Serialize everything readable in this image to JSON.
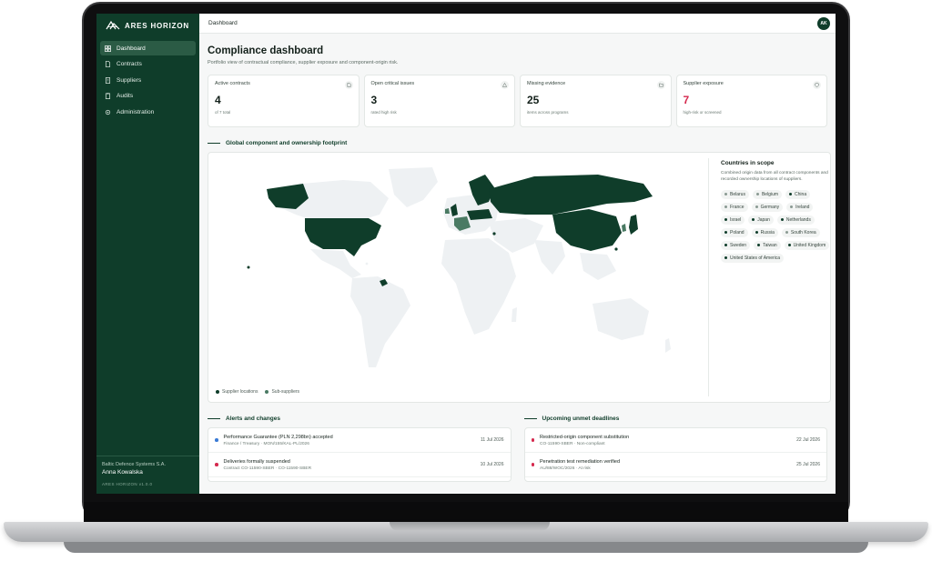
{
  "brand": {
    "name": "ARES HORIZON"
  },
  "topbar": {
    "breadcrumb": "Dashboard",
    "avatar": "AK"
  },
  "sidebar": {
    "items": [
      {
        "label": "Dashboard",
        "icon": "grid-icon"
      },
      {
        "label": "Contracts",
        "icon": "document-icon"
      },
      {
        "label": "Suppliers",
        "icon": "building-icon"
      },
      {
        "label": "Audits",
        "icon": "clipboard-icon"
      },
      {
        "label": "Administration",
        "icon": "gear-icon"
      }
    ],
    "active": "Dashboard",
    "org": "Baltic Defence Systems S.A.",
    "user": "Anna Kowalska",
    "version": "ARES HORIZON v1.0.0"
  },
  "page": {
    "title": "Compliance dashboard",
    "subtitle": "Portfolio view of contractual compliance, supplier exposure and component-origin risk."
  },
  "kpis": [
    {
      "label": "Active contracts",
      "value": "4",
      "foot": "of 7 total",
      "icon": "file-icon",
      "alert": false
    },
    {
      "label": "Open critical issues",
      "value": "3",
      "foot": "rated high risk",
      "icon": "warning-icon",
      "alert": false
    },
    {
      "label": "Missing evidence",
      "value": "25",
      "foot": "items across programs",
      "icon": "folder-icon",
      "alert": false
    },
    {
      "label": "Supplier exposure",
      "value": "7",
      "foot": "high-risk or screened",
      "icon": "shield-icon",
      "alert": true
    }
  ],
  "map_section": {
    "title": "Global component and ownership footprint",
    "legend": [
      {
        "label": "Supplier locations",
        "color": "#0f3d2a"
      },
      {
        "label": "Sub-suppliers",
        "color": "#4a7a63"
      }
    ],
    "scope_title": "Countries in scope",
    "scope_desc": "Combined origin data from all contract components and recorded ownership locations of suppliers.",
    "countries": [
      {
        "name": "Belarus",
        "type": "sub"
      },
      {
        "name": "Belgium",
        "type": "sub"
      },
      {
        "name": "China",
        "type": "main"
      },
      {
        "name": "France",
        "type": "sub"
      },
      {
        "name": "Germany",
        "type": "sub"
      },
      {
        "name": "Ireland",
        "type": "sub"
      },
      {
        "name": "Israel",
        "type": "main"
      },
      {
        "name": "Japan",
        "type": "main"
      },
      {
        "name": "Netherlands",
        "type": "main"
      },
      {
        "name": "Poland",
        "type": "main"
      },
      {
        "name": "Russia",
        "type": "main"
      },
      {
        "name": "South Korea",
        "type": "sub"
      },
      {
        "name": "Sweden",
        "type": "main"
      },
      {
        "name": "Taiwan",
        "type": "main"
      },
      {
        "name": "United Kingdom",
        "type": "main"
      },
      {
        "name": "United States of America",
        "type": "main"
      }
    ]
  },
  "alerts": {
    "title": "Alerts and changes",
    "items": [
      {
        "title": "Performance Guarantee (PLN 2,298bn) accepted",
        "sub": "Finance / Treasury · MON/155/KAL-PL/2026",
        "date": "11 Jul 2026",
        "color": "#3a7bd5"
      },
      {
        "title": "Deliveries formally suspended",
        "sub": "Contract CO-11590-SBER · CO-11590-SBER",
        "date": "10 Jul 2026",
        "color": "#d5294e"
      }
    ]
  },
  "deadlines": {
    "title": "Upcoming unmet deadlines",
    "items": [
      {
        "title": "Restricted-origin component substitution",
        "sub": "CO-11590-SBER · Non-compliant",
        "date": "22 Jul 2026",
        "color": "#d5294e"
      },
      {
        "title": "Penetration test remediation verified",
        "sub": "AU/88/WOC/2026 · At risk",
        "date": "25 Jul 2026",
        "color": "#d5294e"
      }
    ]
  }
}
